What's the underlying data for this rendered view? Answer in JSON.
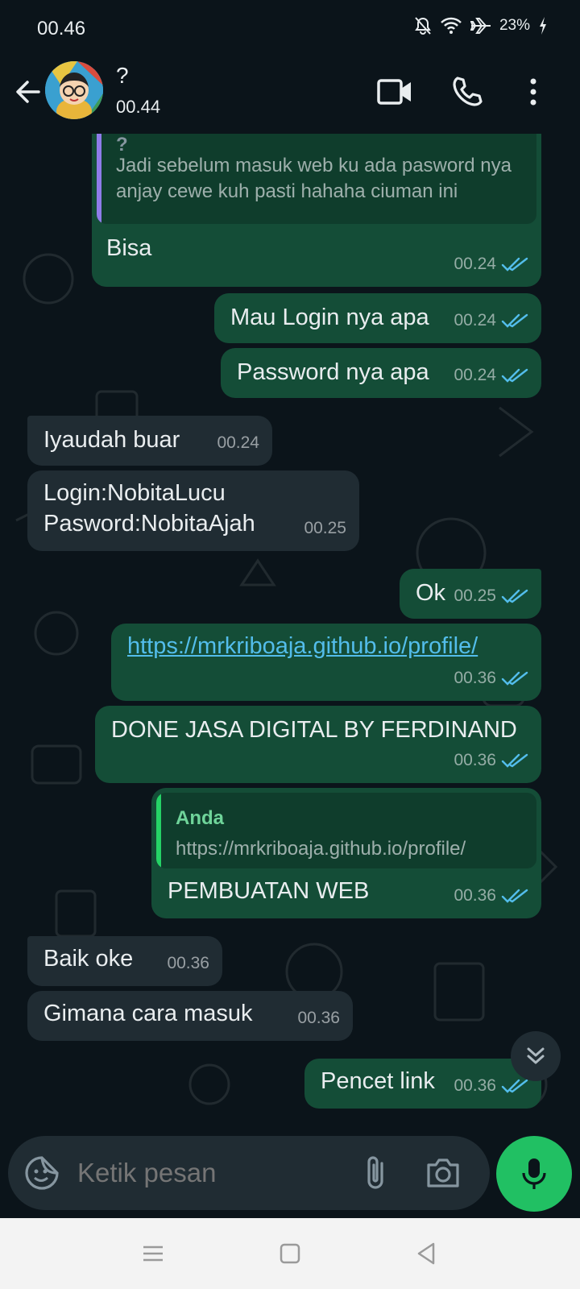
{
  "status_bar": {
    "time": "00.46",
    "battery": "23%",
    "icons": [
      "bell-muted-icon",
      "wifi-icon",
      "airplane-icon",
      "battery-charging-icon"
    ]
  },
  "header": {
    "contact_name": "?",
    "subtitle": "00.44",
    "icons": [
      "back-arrow-icon",
      "video-call-icon",
      "phone-icon",
      "more-vert-icon"
    ]
  },
  "colors": {
    "outgoing_bubble": "#144d37",
    "incoming_bubble": "#202c33",
    "read_ticks": "#53bdeb",
    "accent_green": "#21c063",
    "quote_bar_purple": "#8f7ce9",
    "quote_bar_green": "#25d366"
  },
  "messages": [
    {
      "direction": "out",
      "quote_author": "?",
      "quote_text": "Jadi sebelum masuk web ku ada pasword nya anjay cewe kuh pasti hahaha ciuman ini",
      "text": "Bisa",
      "time": "00.24",
      "status": "read"
    },
    {
      "direction": "out",
      "text": "Mau Login nya apa",
      "time": "00.24",
      "status": "read"
    },
    {
      "direction": "out",
      "text": "Password nya apa",
      "time": "00.24",
      "status": "read"
    },
    {
      "direction": "in",
      "text": "Iyaudah buar",
      "time": "00.24"
    },
    {
      "direction": "in",
      "line1": "Login:NobitaLucu",
      "line2": "Pasword:NobitaAjah",
      "time": "00.25"
    },
    {
      "direction": "out",
      "text": "Ok",
      "time": "00.25",
      "status": "read"
    },
    {
      "direction": "out",
      "text": "https://mrkriboaja.github.io/profile/",
      "time": "00.36",
      "status": "read"
    },
    {
      "direction": "out",
      "text": "DONE JASA DIGITAL BY FERDINAND",
      "time": "00.36",
      "status": "read"
    },
    {
      "direction": "out",
      "quote_author": "Anda",
      "quote_text": "https://mrkriboaja.github.io/profile/",
      "text": "PEMBUATAN WEB",
      "time": "00.36",
      "status": "read"
    },
    {
      "direction": "in",
      "text": "Baik oke",
      "time": "00.36"
    },
    {
      "direction": "in",
      "text": "Gimana cara masuk",
      "time": "00.36"
    },
    {
      "direction": "out",
      "text": "Pencet link",
      "time": "00.36",
      "status": "read"
    }
  ],
  "composer": {
    "placeholder": "Ketik pesan",
    "icons": [
      "emoji-sticker-icon",
      "attach-icon",
      "camera-icon",
      "mic-icon"
    ]
  },
  "nav_bar": {
    "icons": [
      "menu-icon",
      "home-icon",
      "back-icon"
    ]
  }
}
